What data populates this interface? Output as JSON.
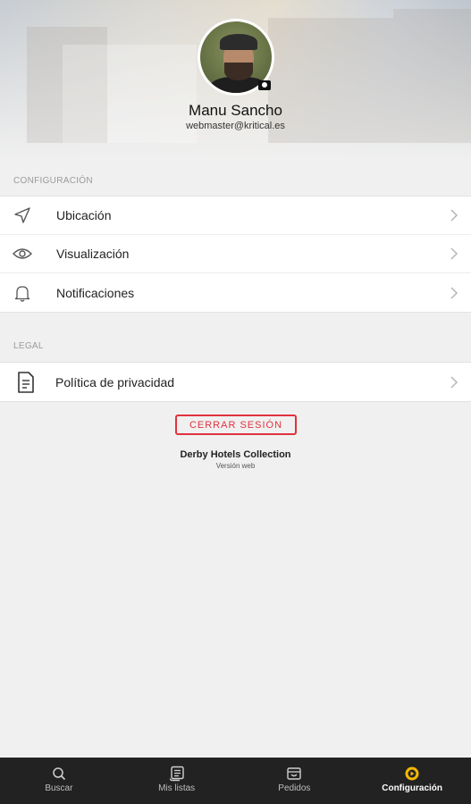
{
  "profile": {
    "name": "Manu Sancho",
    "email": "webmaster@kritical.es"
  },
  "sections": {
    "config_title": "CONFIGURACIÓN",
    "config_items": [
      {
        "label": "Ubicación",
        "icon": "navigation-arrow-icon"
      },
      {
        "label": "Visualización",
        "icon": "eye-icon"
      },
      {
        "label": "Notificaciones",
        "icon": "bell-icon"
      }
    ],
    "legal_title": "LEGAL",
    "legal_items": [
      {
        "label": "Política de privacidad",
        "icon": "document-icon"
      }
    ]
  },
  "logout_label": "CERRAR SESIÓN",
  "footer": {
    "brand": "Derby Hotels Collection",
    "version": "Versión web"
  },
  "tabs": [
    {
      "label": "Buscar",
      "icon": "search-icon",
      "active": false
    },
    {
      "label": "Mis listas",
      "icon": "list-icon",
      "active": false
    },
    {
      "label": "Pedidos",
      "icon": "orders-icon",
      "active": false
    },
    {
      "label": "Configuración",
      "icon": "settings-icon",
      "active": true
    }
  ],
  "colors": {
    "accent": "#e0323d",
    "active_tab": "#f5b800",
    "tabbar_bg": "#222222"
  }
}
